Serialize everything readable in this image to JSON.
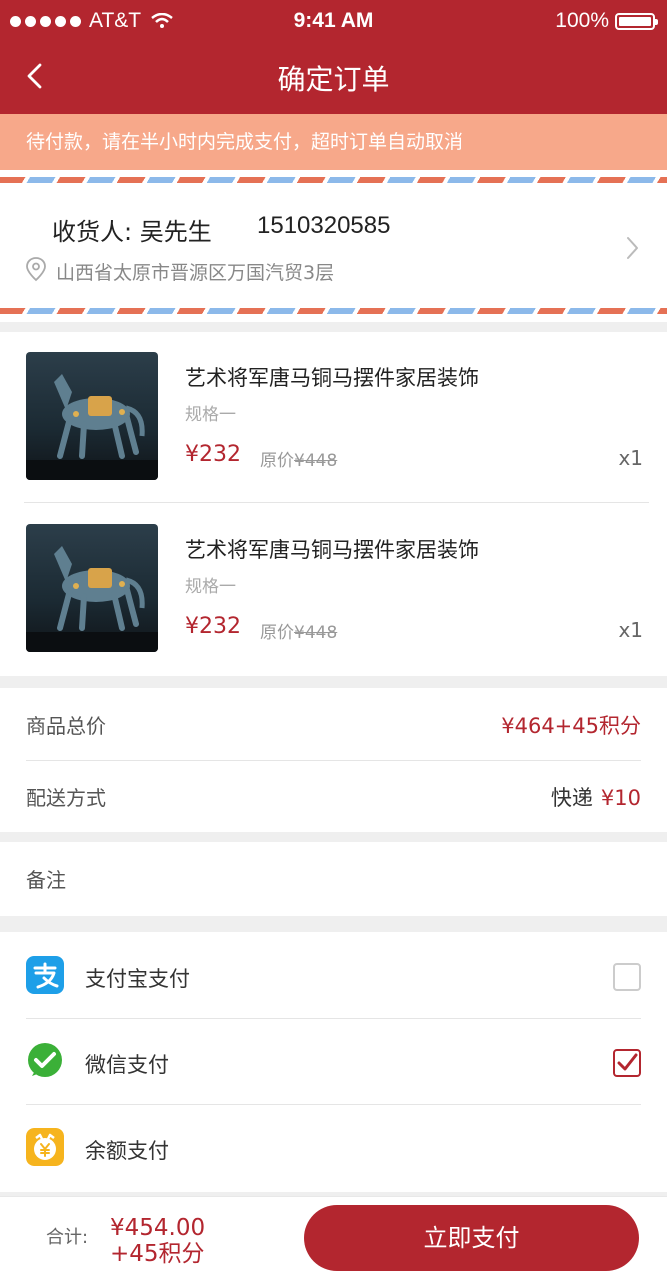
{
  "status_bar": {
    "carrier": "AT&T",
    "time": "9:41 AM",
    "battery": "100%"
  },
  "header": {
    "title": "确定订单"
  },
  "notice": {
    "text": "待付款，请在半小时内完成支付，超时订单自动取消"
  },
  "address": {
    "recipient": "收货人: 吴先生",
    "phone": "1510320585",
    "detail": "山西省太原市晋源区万国汽贸3层"
  },
  "products": [
    {
      "name": "艺术将军唐马铜马摆件家居装饰",
      "spec": "规格一",
      "price": "¥232",
      "orig_label": "原价",
      "orig_price": "¥448",
      "qty": "x1"
    },
    {
      "name": "艺术将军唐马铜马摆件家居装饰",
      "spec": "规格一",
      "price": "¥232",
      "orig_label": "原价",
      "orig_price": "¥448",
      "qty": "x1"
    }
  ],
  "summary": {
    "total_label": "商品总价",
    "total_value": "¥464+45积分",
    "shipping_label": "配送方式",
    "shipping_method": "快递",
    "shipping_fee": "¥10"
  },
  "remark": {
    "label": "备注"
  },
  "payment_methods": [
    {
      "label": "支付宝支付",
      "icon": "alipay-icon",
      "checked": false,
      "color": "#1e9fe8"
    },
    {
      "label": "微信支付",
      "icon": "wechat-icon",
      "checked": true,
      "color": "#3bb038"
    },
    {
      "label": "余额支付",
      "icon": "wallet-icon",
      "checked": null,
      "color": "#f6b41e"
    }
  ],
  "footer": {
    "total_label": "合计:",
    "total_amount": "¥454.00",
    "total_points": "+45积分",
    "pay_button": "立即支付"
  },
  "colors": {
    "brand": "#b3262f",
    "notice_bg": "#f7a88a"
  }
}
